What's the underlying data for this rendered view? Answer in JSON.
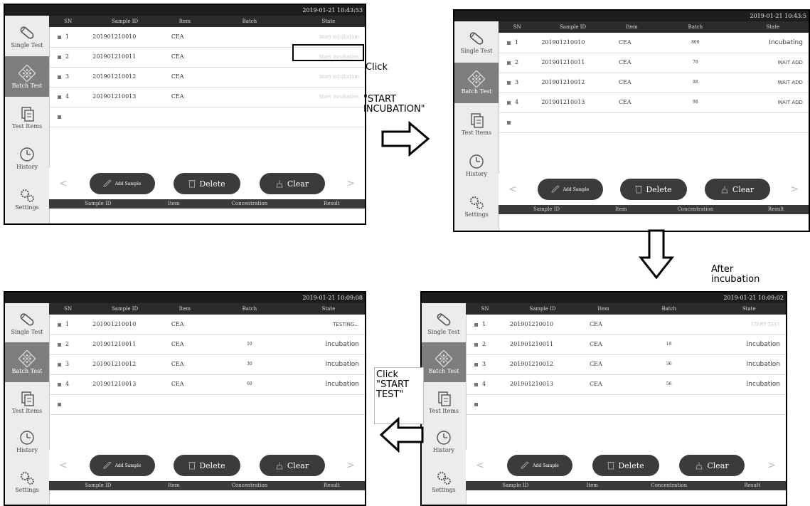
{
  "annotations": {
    "click_1": "Click",
    "click_1_target": "\"START\nINCUBATION\"",
    "after": "After\nincubation",
    "click_2": "Click\n\"START\nTEST\""
  },
  "screens": [
    {
      "timestamp": "2019-01-21 10:43:53",
      "sidebar": [
        "Single Test",
        "Batch Test",
        "Test Items",
        "History",
        "Settings"
      ],
      "table_headers": [
        "SN",
        "Sample ID",
        "Item",
        "Batch",
        "State"
      ],
      "rows": [
        {
          "sn": "1",
          "sample_id": "201901210010",
          "item": "CEA",
          "batch": "",
          "state": "Start Incubation"
        },
        {
          "sn": "2",
          "sample_id": "201901210011",
          "item": "CEA",
          "batch": "",
          "state": "Start Incubation"
        },
        {
          "sn": "3",
          "sample_id": "201901210012",
          "item": "CEA",
          "batch": "",
          "state": "Start Incubation"
        },
        {
          "sn": "4",
          "sample_id": "201901210013",
          "item": "CEA",
          "batch": "",
          "state": "Start Incubation"
        }
      ],
      "buttons": {
        "add": "Add Sample",
        "delete": "Delete",
        "clear": "Clear",
        "prev": "<",
        "next": ">"
      },
      "result_headers": [
        "Sample ID",
        "Item",
        "Concentration",
        "Result"
      ]
    },
    {
      "timestamp": "2019-01-21 10:43:5",
      "sidebar": [
        "Single Test",
        "Batch Test",
        "Test Items",
        "History",
        "Settings"
      ],
      "table_headers": [
        "SN",
        "Sample ID",
        "Item",
        "Batch",
        "State"
      ],
      "rows": [
        {
          "sn": "1",
          "sample_id": "201901210010",
          "item": "CEA",
          "batch": "800",
          "state": "Incubating"
        },
        {
          "sn": "2",
          "sample_id": "201901210011",
          "item": "CEA",
          "batch": "78",
          "state": "WAIT ADD"
        },
        {
          "sn": "3",
          "sample_id": "201901210012",
          "item": "CEA",
          "batch": "98",
          "state": "WAIT ADD"
        },
        {
          "sn": "4",
          "sample_id": "201901210013",
          "item": "CEA",
          "batch": "98",
          "state": "WAIT ADD"
        }
      ],
      "buttons": {
        "add": "Add Sample",
        "delete": "Delete",
        "clear": "Clear",
        "prev": "<",
        "next": ">"
      },
      "result_headers": [
        "Sample ID",
        "Item",
        "Concentration",
        "Result"
      ]
    },
    {
      "timestamp": "2019-01-21 10:09:02",
      "sidebar": [
        "Single Test",
        "Batch Test",
        "Test Items",
        "History",
        "Settings"
      ],
      "table_headers": [
        "SN",
        "Sample ID",
        "Item",
        "Batch",
        "State"
      ],
      "rows": [
        {
          "sn": "1",
          "sample_id": "201901210010",
          "item": "CEA",
          "batch": "",
          "state": "START TEST"
        },
        {
          "sn": "2",
          "sample_id": "201901210011",
          "item": "CEA",
          "batch": "18",
          "state": "Incubation"
        },
        {
          "sn": "3",
          "sample_id": "201901210012",
          "item": "CEA",
          "batch": "36",
          "state": "Incubation"
        },
        {
          "sn": "4",
          "sample_id": "201901210013",
          "item": "CEA",
          "batch": "56",
          "state": "Incubation"
        }
      ],
      "buttons": {
        "add": "Add Sample",
        "delete": "Delete",
        "clear": "Clear",
        "prev": "<",
        "next": ">"
      },
      "result_headers": [
        "Sample ID",
        "Item",
        "Concentration",
        "Result"
      ]
    },
    {
      "timestamp": "2019-01-21 10:09:08",
      "sidebar": [
        "Single Test",
        "Batch Test",
        "Test Items",
        "History",
        "Settings"
      ],
      "table_headers": [
        "SN",
        "Sample ID",
        "Item",
        "Batch",
        "State"
      ],
      "rows": [
        {
          "sn": "1",
          "sample_id": "201901210010",
          "item": "CEA",
          "batch": "",
          "state": "TESTING..."
        },
        {
          "sn": "2",
          "sample_id": "201901210011",
          "item": "CEA",
          "batch": "10",
          "state": "Incubation"
        },
        {
          "sn": "3",
          "sample_id": "201901210012",
          "item": "CEA",
          "batch": "30",
          "state": "Incubation"
        },
        {
          "sn": "4",
          "sample_id": "201901210013",
          "item": "CEA",
          "batch": "60",
          "state": "Incubation"
        }
      ],
      "buttons": {
        "add": "Add Sample",
        "delete": "Delete",
        "clear": "Clear",
        "prev": "<",
        "next": ">"
      },
      "result_headers": [
        "Sample ID",
        "Item",
        "Concentration",
        "Result"
      ]
    }
  ]
}
